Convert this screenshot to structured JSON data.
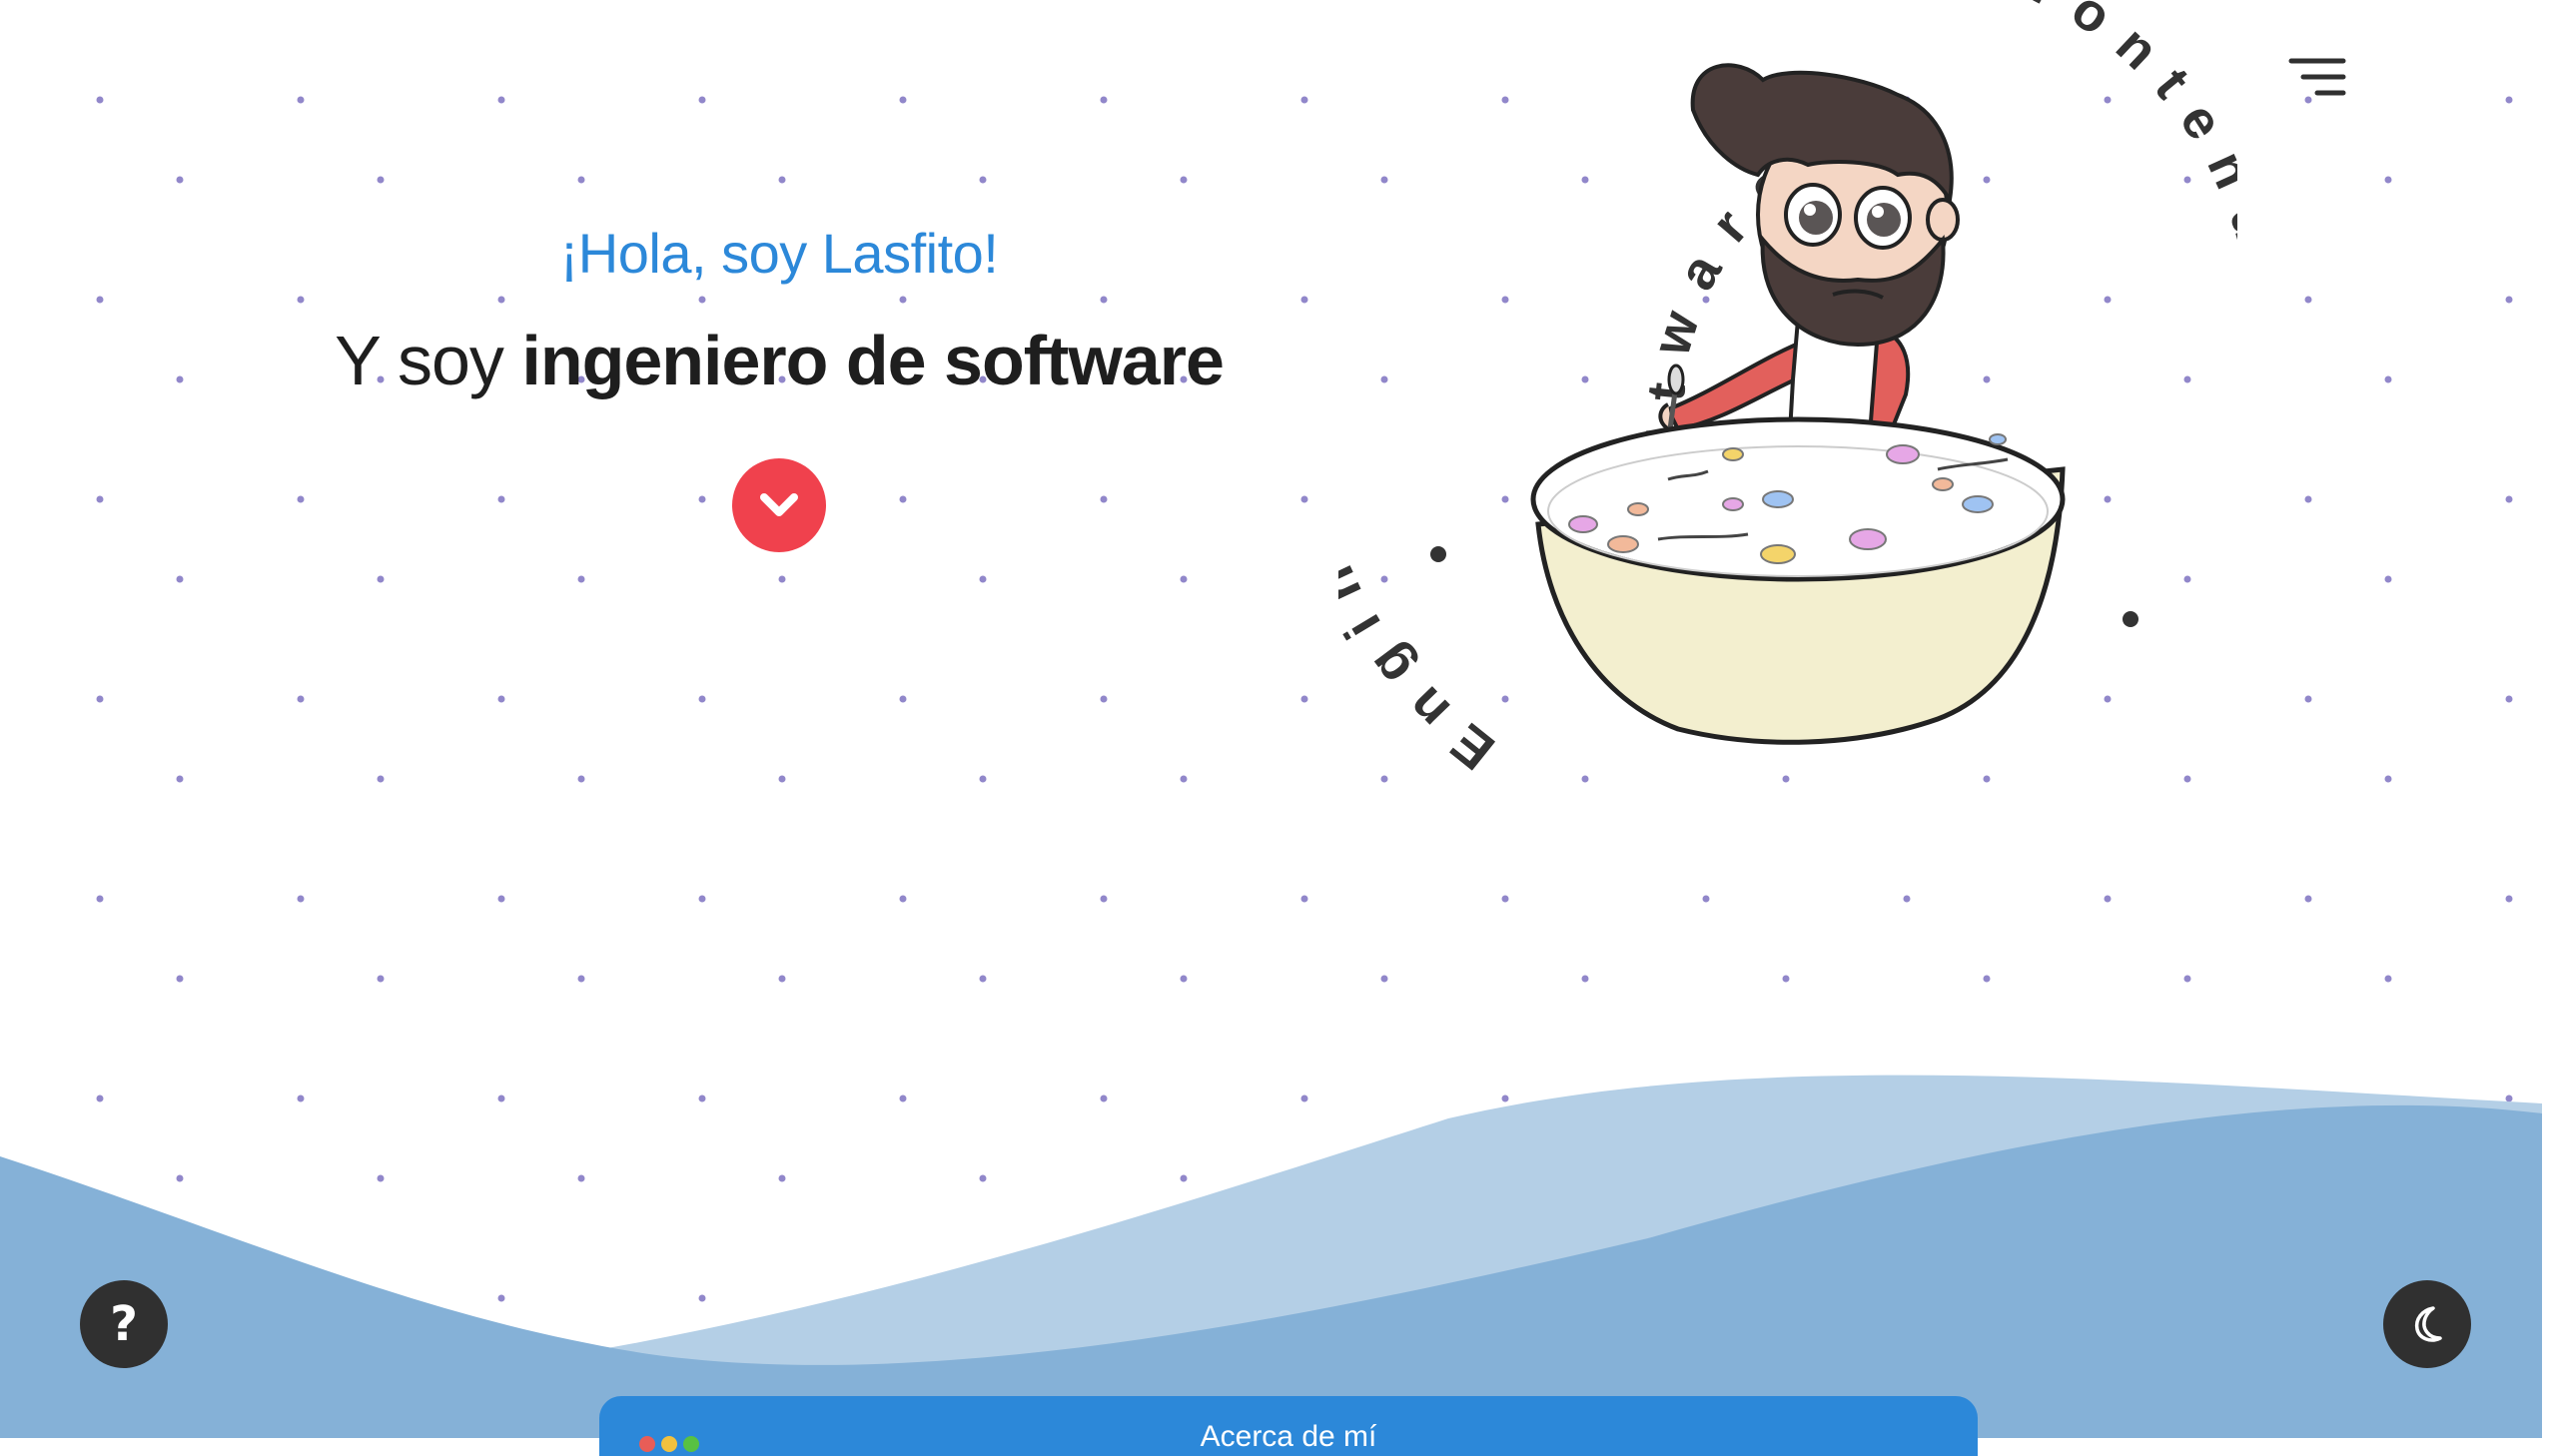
{
  "hero": {
    "greeting": "¡Hola, soy Lasfito!",
    "subtitle_prefix": "Y soy ",
    "subtitle_emphasis": "ingeniero de software"
  },
  "badge": {
    "ring_text": "Software Engineer",
    "ring_text_right": "Frontend"
  },
  "window": {
    "title": "Acerca de mí"
  },
  "icons": {
    "scroll": "chevron-down-icon",
    "menu": "menu-icon",
    "help": "question-icon",
    "theme": "moon-icon"
  },
  "colors": {
    "accent": "#2c88d9",
    "scroll_button": "#f0414d",
    "floating_button": "#303030",
    "wave_back": "#b4cfe6",
    "wave_front": "#85b1d7",
    "dot": "#6c5fb8"
  }
}
